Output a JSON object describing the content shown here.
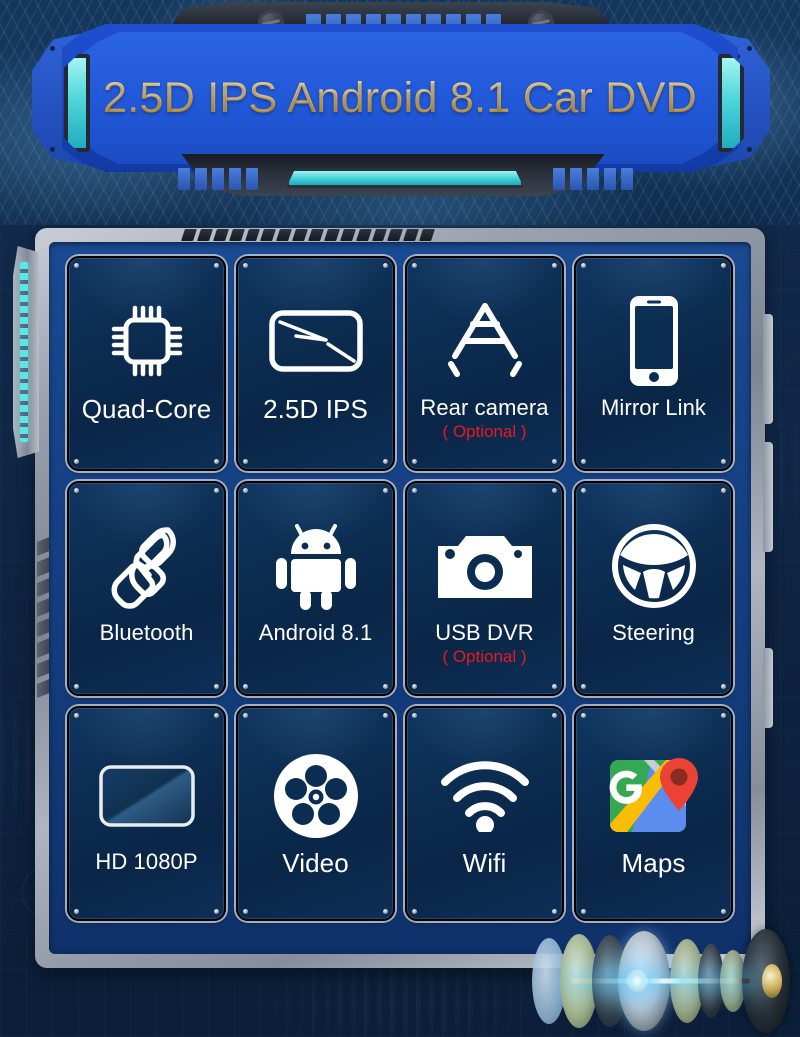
{
  "banner": {
    "title": "2.5D IPS Android 8.1 Car DVD",
    "title_color": "#e6c97e",
    "plate_color": "#2158d8",
    "accent_color": "#4fd6da"
  },
  "panel": {
    "screen_color": "#123a78",
    "frame_color": "#9aa1ad",
    "tile_color": "#0c2d52",
    "optional_color": "#e8191f",
    "features": [
      {
        "label": "Quad-Core",
        "icon": "cpu-chip-icon",
        "sub": ""
      },
      {
        "label": "2.5D IPS",
        "icon": "ips-screen-icon",
        "sub": ""
      },
      {
        "label": "Rear camera",
        "icon": "rear-camera-icon",
        "sub": "( Optional )"
      },
      {
        "label": "Mirror Link",
        "icon": "smartphone-icon",
        "sub": ""
      },
      {
        "label": "Bluetooth",
        "icon": "phone-handset-icon",
        "sub": ""
      },
      {
        "label": "Android 8.1",
        "icon": "android-robot-icon",
        "sub": ""
      },
      {
        "label": "USB DVR",
        "icon": "camera-icon",
        "sub": "( Optional )"
      },
      {
        "label": "Steering",
        "icon": "steering-wheel-icon",
        "sub": ""
      },
      {
        "label": "HD 1080P",
        "icon": "display-panel-icon",
        "sub": ""
      },
      {
        "label": "Video",
        "icon": "film-reel-icon",
        "sub": ""
      },
      {
        "label": "Wifi",
        "icon": "wifi-icon",
        "sub": ""
      },
      {
        "label": "Maps",
        "icon": "google-maps-icon",
        "sub": ""
      }
    ]
  },
  "decor": {
    "speaker_assembly": "exploded-speaker-driver-graphic"
  }
}
